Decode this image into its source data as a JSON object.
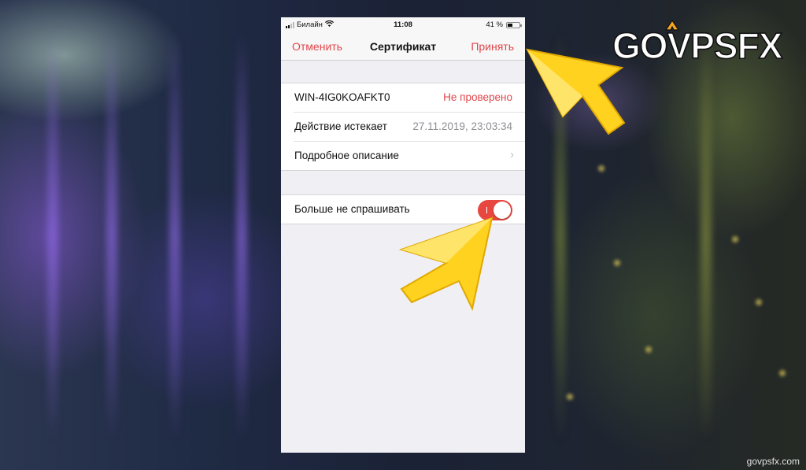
{
  "status_bar": {
    "carrier": "Билайн",
    "time": "11:08",
    "battery": "41 %"
  },
  "nav": {
    "cancel_label": "Отменить",
    "title": "Сертификат",
    "accept_label": "Принять"
  },
  "certificate": {
    "host": "WIN-4IG0KOAFKT0",
    "status": "Не проверено",
    "expires_label": "Действие истекает",
    "expires_value": "27.11.2019, 23:03:34",
    "details_label": "Подробное описание"
  },
  "settings": {
    "dont_ask_label": "Больше не спрашивать",
    "dont_ask_enabled": true
  },
  "branding": {
    "logo": "GOVPSFX",
    "watermark": "govpsfx.com"
  },
  "colors": {
    "accent_red": "#e0474c",
    "toggle_red": "#e8473f",
    "arrow_yellow": "#ffd21f"
  }
}
